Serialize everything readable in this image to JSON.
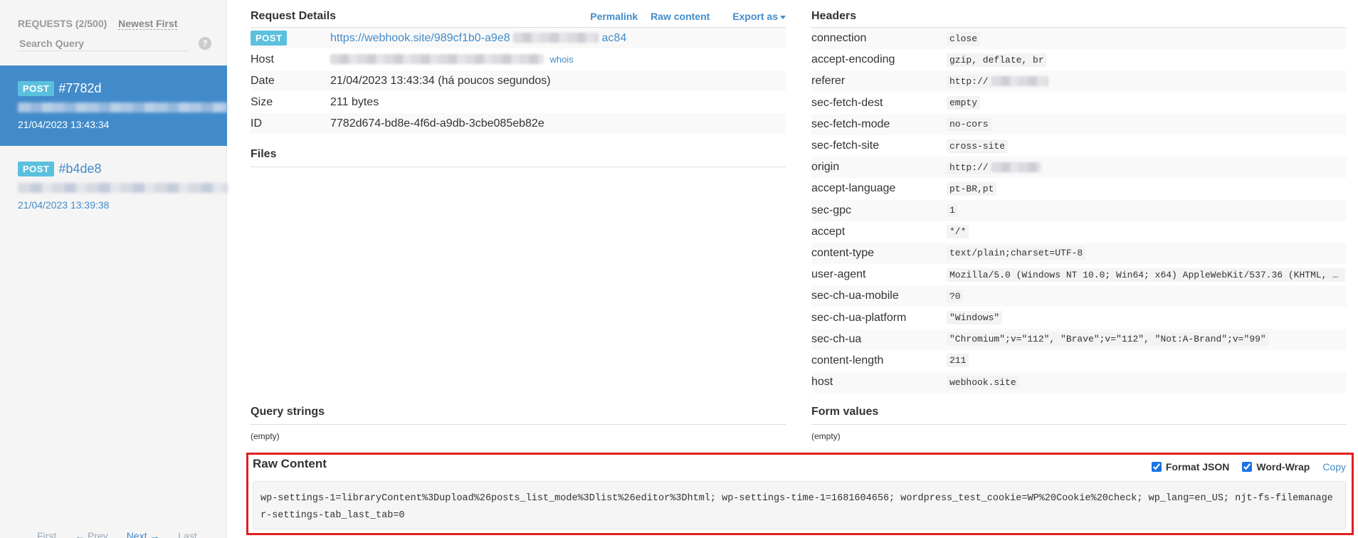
{
  "sidebar": {
    "requests_label": "REQUESTS (2/500)",
    "sort_label": "Newest First",
    "search_placeholder": "Search Query",
    "help": "?",
    "requests": [
      {
        "method": "POST",
        "id": "#7782d",
        "time": "21/04/2023 13:43:34",
        "active": true
      },
      {
        "method": "POST",
        "id": "#b4de8",
        "time": "21/04/2023 13:39:38",
        "active": false
      }
    ],
    "pager": {
      "first": "First",
      "prev": "← Prev",
      "next": "Next →",
      "last": "Last"
    }
  },
  "details": {
    "title": "Request Details",
    "actions": {
      "permalink": "Permalink",
      "raw": "Raw content",
      "export": "Export as"
    },
    "method": "POST",
    "url_start": "https://webhook.site/989cf1b0-a9e8",
    "url_end": "ac84",
    "host_label": "Host",
    "whois": "whois",
    "date_label": "Date",
    "date_value": "21/04/2023 13:43:34 (há poucos segundos)",
    "size_label": "Size",
    "size_value": "211 bytes",
    "id_label": "ID",
    "id_value": "7782d674-bd8e-4f6d-a9db-3cbe085eb82e"
  },
  "files": {
    "title": "Files"
  },
  "headers": {
    "title": "Headers",
    "rows": [
      {
        "k": "connection",
        "v": "close"
      },
      {
        "k": "accept-encoding",
        "v": "gzip, deflate, br"
      },
      {
        "k": "referer",
        "v": "http://"
      },
      {
        "k": "sec-fetch-dest",
        "v": "empty"
      },
      {
        "k": "sec-fetch-mode",
        "v": "no-cors"
      },
      {
        "k": "sec-fetch-site",
        "v": "cross-site"
      },
      {
        "k": "origin",
        "v": "http://"
      },
      {
        "k": "accept-language",
        "v": "pt-BR,pt"
      },
      {
        "k": "sec-gpc",
        "v": "1"
      },
      {
        "k": "accept",
        "v": "*/*"
      },
      {
        "k": "content-type",
        "v": "text/plain;charset=UTF-8"
      },
      {
        "k": "user-agent",
        "v": "Mozilla/5.0 (Windows NT 10.0; Win64; x64) AppleWebKit/537.36 (KHTML, ..."
      },
      {
        "k": "sec-ch-ua-mobile",
        "v": "?0"
      },
      {
        "k": "sec-ch-ua-platform",
        "v": "\"Windows\""
      },
      {
        "k": "sec-ch-ua",
        "v": "\"Chromium\";v=\"112\", \"Brave\";v=\"112\", \"Not:A-Brand\";v=\"99\""
      },
      {
        "k": "content-length",
        "v": "211"
      },
      {
        "k": "host",
        "v": "webhook.site"
      }
    ]
  },
  "query": {
    "title": "Query strings",
    "empty": "(empty)"
  },
  "form": {
    "title": "Form values",
    "empty": "(empty)"
  },
  "raw": {
    "title": "Raw Content",
    "format_json": "Format JSON",
    "word_wrap": "Word-Wrap",
    "copy": "Copy",
    "body": "wp-settings-1=libraryContent%3Dupload%26posts_list_mode%3Dlist%26editor%3Dhtml; wp-settings-time-1=1681604656; wordpress_test_cookie=WP%20Cookie%20check; wp_lang=en_US; njt-fs-filemanager-settings-tab_last_tab=0"
  }
}
